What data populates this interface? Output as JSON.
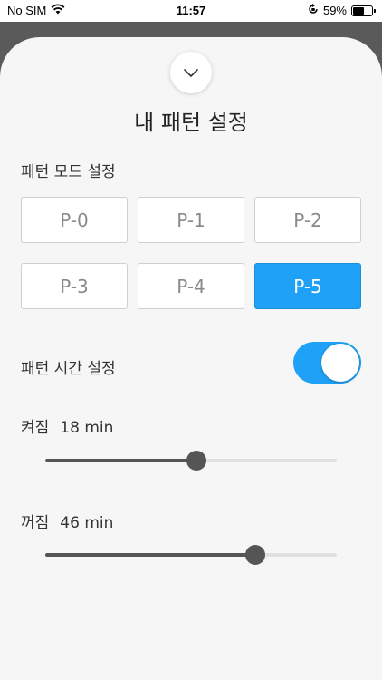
{
  "status_bar": {
    "carrier": "No SIM",
    "time": "11:57",
    "battery": "59%",
    "battery_level": 0.59
  },
  "sheet": {
    "title": "내 패턴 설정",
    "pattern_mode": {
      "label": "패턴 모드 설정",
      "options": [
        "P-0",
        "P-1",
        "P-2",
        "P-3",
        "P-4",
        "P-5"
      ],
      "selected": "P-5"
    },
    "pattern_time": {
      "label": "패턴 시간 설정",
      "enabled": true
    },
    "on_slider": {
      "label": "켜짐",
      "value_text": "18 min",
      "fraction": 0.52
    },
    "off_slider": {
      "label": "꺼짐",
      "value_text": "46 min",
      "fraction": 0.72
    }
  },
  "colors": {
    "accent": "#1ea1f6",
    "backdrop": "#5a5a5a",
    "sheet": "#f6f6f6",
    "slider": "#555555"
  }
}
